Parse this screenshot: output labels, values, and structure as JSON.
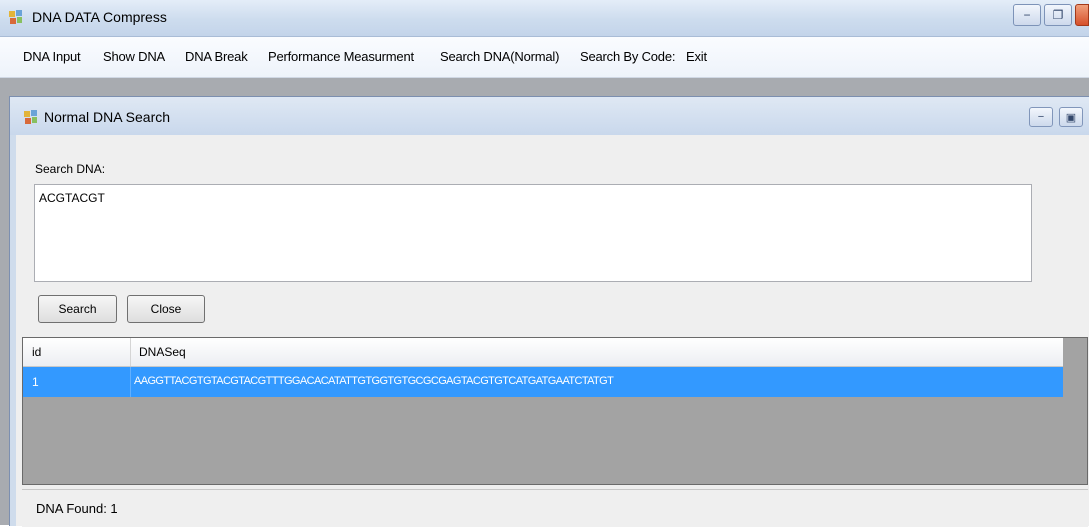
{
  "app": {
    "title": "DNA DATA Compress",
    "icons": {
      "app": "app-icon",
      "minimize": "minimize-icon",
      "restore": "restore-icon",
      "close": "close-icon"
    }
  },
  "menu": {
    "items": [
      {
        "label": "DNA Input"
      },
      {
        "label": "Show DNA"
      },
      {
        "label": "DNA Break"
      },
      {
        "label": "Performance Measurment"
      },
      {
        "label": "Search DNA(Normal)"
      },
      {
        "label": "Search By Code:"
      },
      {
        "label": "Exit"
      }
    ]
  },
  "child_window": {
    "title": "Normal DNA Search",
    "search_label": "Search DNA:",
    "search_value": "ACGTACGT",
    "search_button": "Search",
    "close_button": "Close",
    "grid": {
      "columns": [
        "id",
        "DNASeq"
      ],
      "rows": [
        {
          "id": "1",
          "seq": "AAGGTTACGTGTACGTACGTTTGGACACATATTGTGGTGTGCGCGAGTACGTGTCATGATGAATCTATGT"
        }
      ]
    },
    "status": "DNA Found: 1"
  },
  "colors": {
    "selection": "#3399ff",
    "mdi_background": "#a8abb0"
  }
}
